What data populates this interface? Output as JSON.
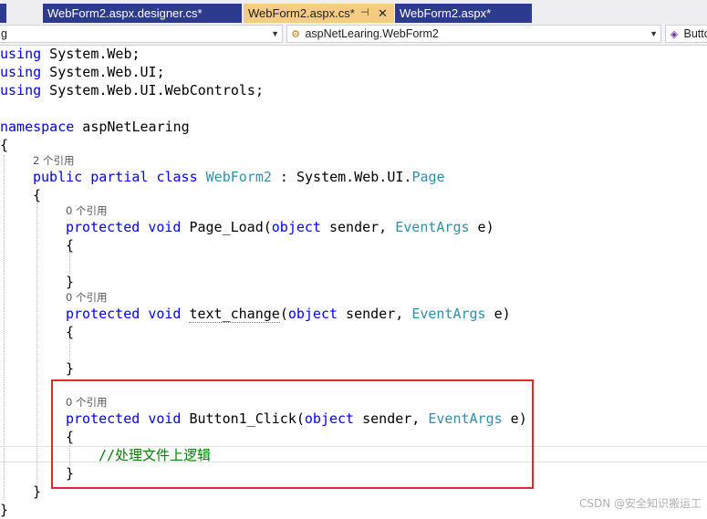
{
  "tabs": [
    {
      "label": "WebForm2.aspx.designer.cs*"
    },
    {
      "label": "WebForm2.aspx.cs*",
      "pin": "⊣",
      "close": "✕"
    },
    {
      "label": "WebForm2.aspx*"
    }
  ],
  "navbar": {
    "project_dropdown": "g",
    "class_dropdown": "aspNetLearing.WebForm2",
    "member_dropdown": "Butto"
  },
  "code": {
    "using1": {
      "kw": "using",
      "rest": " System.Web;"
    },
    "using2": {
      "kw": "using",
      "rest": " System.Web.UI;"
    },
    "using3": {
      "kw": "using",
      "rest": " System.Web.UI.WebControls;"
    },
    "ns": {
      "kw": "namespace",
      "rest": " aspNetLearing"
    },
    "brace_open": "{",
    "brace_close": "}",
    "class_refs": "2 个引用",
    "class_decl": {
      "kw1": "public",
      "kw2": "partial",
      "kw3": "class",
      "name": "WebForm2",
      "mid": " : System.Web.UI.",
      "base": "Page"
    },
    "method1": {
      "refs": "0 个引用",
      "kw1": "protected",
      "kw2": "void",
      "name": " Page_Load(",
      "kw3": "object",
      "p1": " sender, ",
      "type": "EventArgs",
      "p2": " e)"
    },
    "method2": {
      "refs": "0 个引用",
      "kw1": "protected",
      "kw2": "void",
      "name": "text_change",
      "paren": "(",
      "kw3": "object",
      "p1": " sender, ",
      "type": "EventArgs",
      "p2": " e)"
    },
    "method3": {
      "refs": "0 个引用",
      "kw1": "protected",
      "kw2": "void",
      "name": " Button1_Click(",
      "kw3": "object",
      "p1": " sender, ",
      "type": "EventArgs",
      "p2": " e)",
      "comment": "//处理文件上逻辑"
    }
  },
  "watermark": "CSDN @安全知识搬运工"
}
